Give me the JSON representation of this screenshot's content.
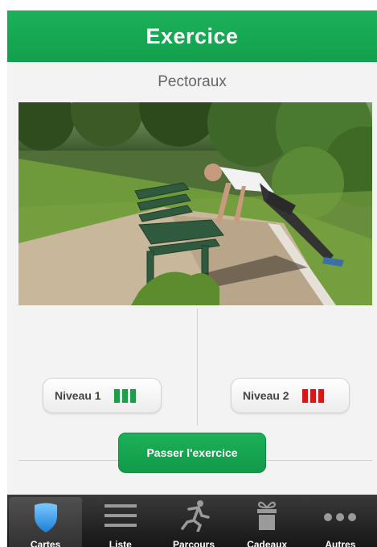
{
  "header": {
    "title": "Exercice"
  },
  "exercise": {
    "name": "Pectoraux"
  },
  "levels": [
    {
      "label": "Niveau 1",
      "color": "#1f9e49"
    },
    {
      "label": "Niveau 2",
      "color": "#d8171b"
    }
  ],
  "skip_button": {
    "label": "Passer l'exercice"
  },
  "tabs": [
    {
      "label": "Cartes",
      "icon": "map-pin-icon",
      "active": true
    },
    {
      "label": "Liste",
      "icon": "list-icon",
      "active": false
    },
    {
      "label": "Parcours",
      "icon": "runner-icon",
      "active": false
    },
    {
      "label": "Cadeaux",
      "icon": "gift-icon",
      "active": false
    },
    {
      "label": "Autres",
      "icon": "more-icon",
      "active": false
    }
  ],
  "colors": {
    "brand": "#12a04c",
    "level_low": "#1f9e49",
    "level_high": "#d8171b"
  }
}
